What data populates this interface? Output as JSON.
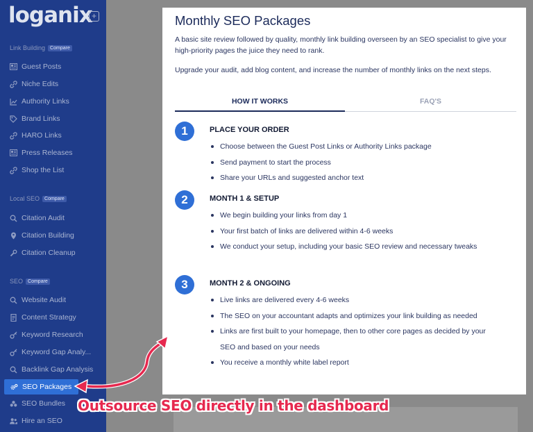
{
  "sidebar": {
    "logo": "loganix",
    "plus": "+",
    "sections": [
      {
        "label": "Link Building",
        "badge": "Compare",
        "items": [
          {
            "label": "Guest Posts",
            "icon": "newspaper-icon"
          },
          {
            "label": "Niche Edits",
            "icon": "link-icon"
          },
          {
            "label": "Authority Links",
            "icon": "chart-line-icon"
          },
          {
            "label": "Brand Links",
            "icon": "tag-icon"
          },
          {
            "label": "HARO Links",
            "icon": "link-icon"
          },
          {
            "label": "Press Releases",
            "icon": "newspaper-icon"
          },
          {
            "label": "Shop the List",
            "icon": "link-icon"
          }
        ]
      },
      {
        "label": "Local SEO",
        "badge": "Compare",
        "items": [
          {
            "label": "Citation Audit",
            "icon": "search-icon"
          },
          {
            "label": "Citation Building",
            "icon": "map-pin-icon"
          },
          {
            "label": "Citation Cleanup",
            "icon": "wrench-icon"
          }
        ]
      },
      {
        "label": "SEO",
        "badge": "Compare",
        "items": [
          {
            "label": "Website Audit",
            "icon": "search-icon"
          },
          {
            "label": "Content Strategy",
            "icon": "document-icon"
          },
          {
            "label": "Keyword Research",
            "icon": "key-icon"
          },
          {
            "label": "Keyword Gap Analy...",
            "icon": "key-icon"
          },
          {
            "label": "Backlink Gap Analysis",
            "icon": "search-icon"
          },
          {
            "label": "SEO Packages",
            "icon": "gears-icon",
            "active": true
          },
          {
            "label": "SEO Bundles",
            "icon": "bundle-icon"
          },
          {
            "label": "Hire an SEO",
            "icon": "users-icon"
          }
        ]
      }
    ]
  },
  "main": {
    "title": "Monthly SEO Packages",
    "description": "A basic site review followed by quality, monthly link building overseen by an SEO specialist to give your high-priority pages the juice they need to rank.",
    "upgrade_text": "Upgrade your audit, add blog content, and increase the number of monthly links on the next steps.",
    "tabs": [
      {
        "label": "HOW IT WORKS",
        "active": true
      },
      {
        "label": "FAQ'S",
        "active": false
      }
    ],
    "steps": [
      {
        "number": "1",
        "title": "PLACE YOUR ORDER",
        "items": [
          "Choose between the Guest Post Links or Authority Links package",
          "Send payment to start the process",
          "Share your URLs and suggested anchor text"
        ]
      },
      {
        "number": "2",
        "title": "MONTH 1 & SETUP",
        "items": [
          "We begin building your links from day 1",
          "Your first batch of links are delivered within 4-6 weeks",
          "We conduct your setup, including your basic SEO review and necessary tweaks"
        ]
      },
      {
        "number": "3",
        "title": "MONTH 2 & ONGOING",
        "items": [
          "Live links are delivered every 4-6 weeks",
          "The SEO on your accountant adapts and optimizes your link building as needed",
          "Links are first built to your homepage, then to other core pages as decided by your SEO and based on your needs",
          "You receive a monthly white label report"
        ]
      }
    ]
  },
  "annotation": {
    "text": "Outsource SEO directly in the dashboard",
    "color": "#e6294f"
  },
  "colors": {
    "sidebar_bg": "#1f3c8a",
    "accent": "#2f6fd6",
    "heading": "#1b2a5a"
  }
}
